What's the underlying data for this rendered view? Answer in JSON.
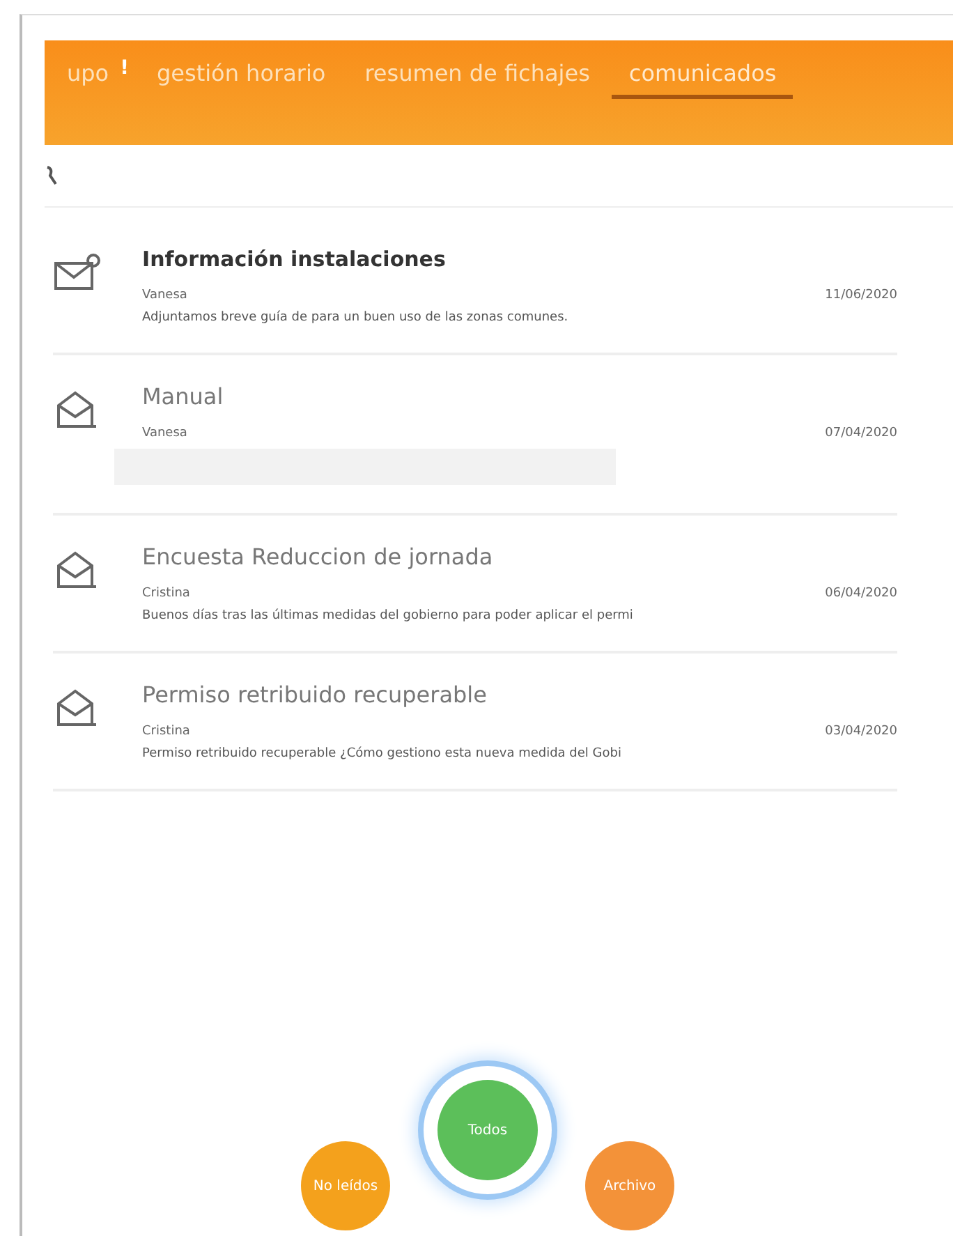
{
  "tabs": [
    {
      "label": "upo",
      "badge": "!",
      "selected": false
    },
    {
      "label": "gestión horario",
      "selected": false
    },
    {
      "label": "resumen de fichajes",
      "selected": false
    },
    {
      "label": "comunicados",
      "selected": true
    }
  ],
  "messages": [
    {
      "title": "Información instalaciones",
      "read": false,
      "author": "Vanesa",
      "date": "11/06/2020",
      "preview": "Adjuntamos breve guía de para un buen uso de las zonas comunes."
    },
    {
      "title": "Manual",
      "read": true,
      "author": "Vanesa",
      "date": "07/04/2020"
    },
    {
      "title": "Encuesta Reduccion de jornada",
      "read": true,
      "author": "Cristina",
      "date": "06/04/2020",
      "preview": "Buenos días tras las últimas medidas del gobierno para poder aplicar el permi"
    },
    {
      "title": "Permiso retribuido recuperable",
      "read": true,
      "author": "Cristina",
      "date": "03/04/2020",
      "preview": "Permiso retribuido recuperable ¿Cómo gestiono esta nueva medida del Gobi"
    }
  ],
  "filters": [
    {
      "label": "No leídos",
      "selected": false,
      "color": "#f4a11c"
    },
    {
      "label": "Todos",
      "selected": true,
      "color": "#5cbf5a"
    },
    {
      "label": "Archivo",
      "selected": false,
      "color": "#f39239"
    }
  ]
}
